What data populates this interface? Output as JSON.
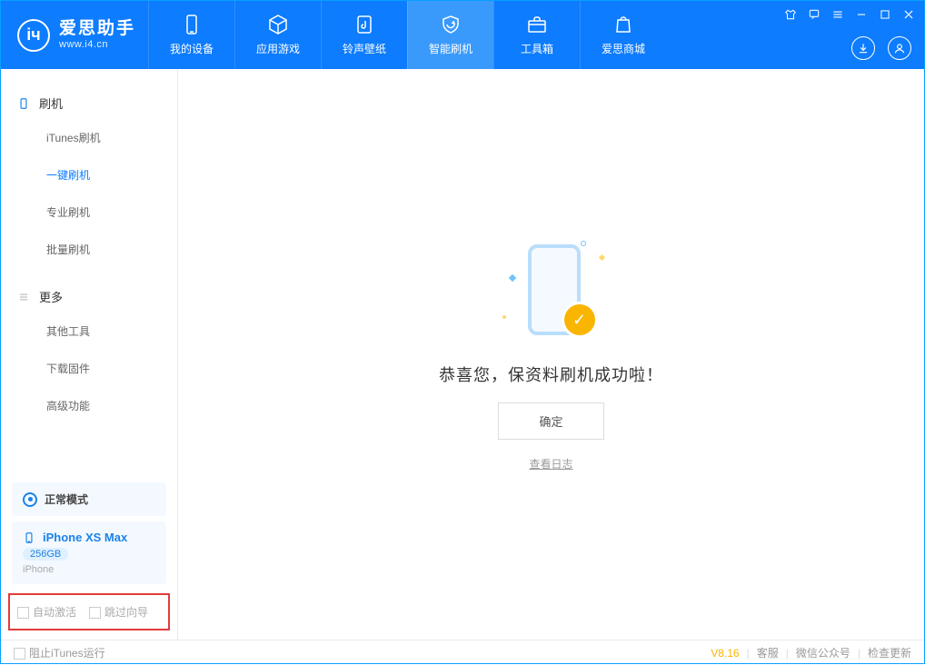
{
  "app": {
    "title": "爱思助手",
    "subtitle": "www.i4.cn"
  },
  "tabs": {
    "device": "我的设备",
    "apps": "应用游戏",
    "ringtones": "铃声壁纸",
    "flash": "智能刷机",
    "toolbox": "工具箱",
    "store": "爱思商城"
  },
  "sidebar": {
    "group_flash": "刷机",
    "itunes_flash": "iTunes刷机",
    "easy_flash": "一键刷机",
    "pro_flash": "专业刷机",
    "batch_flash": "批量刷机",
    "group_more": "更多",
    "other_tools": "其他工具",
    "download_fw": "下载固件",
    "advanced": "高级功能"
  },
  "mode": {
    "label": "正常模式"
  },
  "device": {
    "name": "iPhone XS Max",
    "capacity": "256GB",
    "type": "iPhone"
  },
  "options": {
    "auto_activate": "自动激活",
    "skip_guide": "跳过向导"
  },
  "main": {
    "success_text": "恭喜您，保资料刷机成功啦！",
    "ok": "确定",
    "view_log": "查看日志"
  },
  "footer": {
    "block_itunes": "阻止iTunes运行",
    "version": "V8.16",
    "support": "客服",
    "wechat": "微信公众号",
    "check_update": "检查更新"
  }
}
